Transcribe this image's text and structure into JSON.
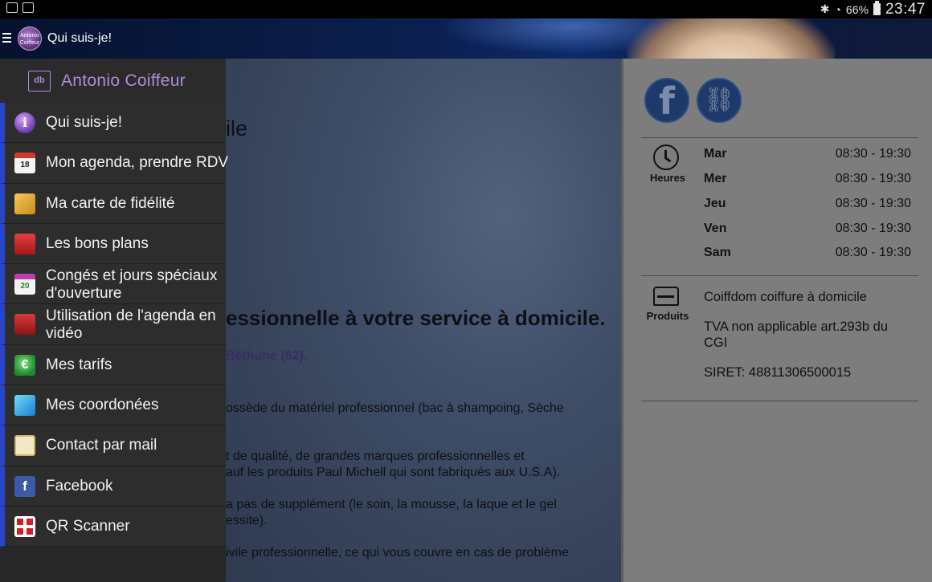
{
  "status_bar": {
    "battery": "66%",
    "time": "23:47"
  },
  "app_bar": {
    "title": "Qui suis-je!",
    "logo_text": "Antonio Coiffeur"
  },
  "drawer": {
    "brand_icon_text": "db",
    "brand_name": "Antonio Coiffeur",
    "items": [
      {
        "label": "Qui suis-je!",
        "icon": "info-icon"
      },
      {
        "label": "Mon agenda, prendre RDV",
        "icon": "calendar-icon",
        "icon_text": "18"
      },
      {
        "label": "Ma carte de fidélité",
        "icon": "loyalty-card-icon"
      },
      {
        "label": "Les bons plans",
        "icon": "deals-icon"
      },
      {
        "label": "Congés et jours spéciaux d'ouverture",
        "icon": "holiday-calendar-icon",
        "icon_text": "20"
      },
      {
        "label": "Utilisation de l'agenda en vidéo",
        "icon": "video-icon"
      },
      {
        "label": "Mes tarifs",
        "icon": "euro-icon",
        "icon_text": "€"
      },
      {
        "label": "Mes coordonées",
        "icon": "contact-icon"
      },
      {
        "label": "Contact  par mail",
        "icon": "mail-icon"
      },
      {
        "label": "Facebook",
        "icon": "facebook-icon",
        "icon_text": "f"
      },
      {
        "label": "QR Scanner",
        "icon": "qr-code-icon"
      }
    ]
  },
  "content": {
    "heading": "ile",
    "subheading": "essionnelle à votre service à domicile.",
    "location": "Béthune (62).",
    "paragraphs": [
      "ossède du matériel professionnel (bac à shampoing, Sèche",
      "t de qualité, de grandes marques professionnelles et",
      "auf les produits Paul Michell qui sont fabriqués aux U.S.A).",
      "a pas de supplément (le soin, la mousse, la laque et le gel",
      "essite).",
      "ivile professionnelle, ce qui vous couvre en cas de problème"
    ]
  },
  "right_panel": {
    "hours_label": "Heures",
    "hours": [
      {
        "day": "Mar",
        "time": "08:30 - 19:30"
      },
      {
        "day": "Mer",
        "time": "08:30 - 19:30"
      },
      {
        "day": "Jeu",
        "time": "08:30 - 19:30"
      },
      {
        "day": "Ven",
        "time": "08:30 - 19:30"
      },
      {
        "day": "Sam",
        "time": "08:30 - 19:30"
      }
    ],
    "products_label": "Produits",
    "company": "Coiffdom coiffure à domicile",
    "tva": "TVA non applicable art.293b du CGI",
    "siret": "SIRET: 48811306500015"
  }
}
